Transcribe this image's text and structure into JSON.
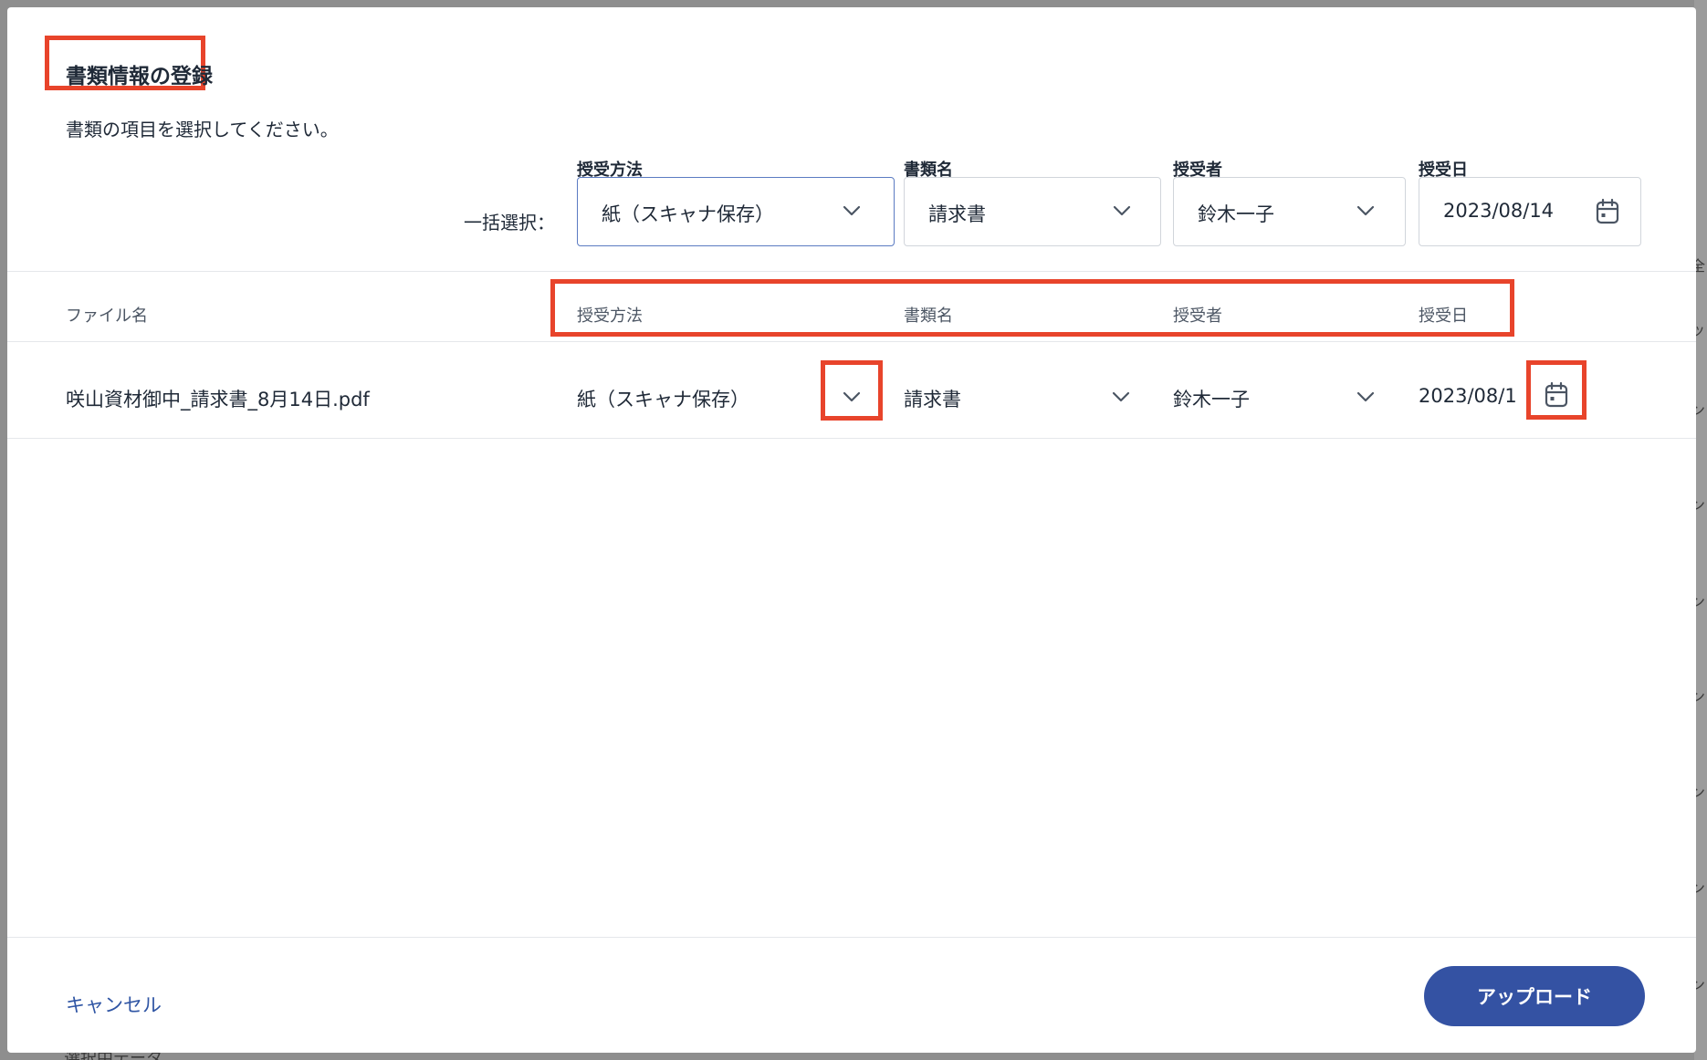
{
  "modal": {
    "title": "書類情報の登録",
    "subtitle": "書類の項目を選択してください。"
  },
  "bulk": {
    "label": "一括選択：",
    "fields": [
      {
        "label": "授受方法",
        "value": "紙（スキャナ保存）",
        "icon": "chevron-down-icon"
      },
      {
        "label": "書類名",
        "value": "請求書",
        "icon": "chevron-down-icon"
      },
      {
        "label": "授受者",
        "value": "鈴木一子",
        "icon": "chevron-down-icon"
      },
      {
        "label": "授受日",
        "value": "2023/08/14",
        "icon": "calendar-icon"
      }
    ]
  },
  "table": {
    "columns": [
      "ファイル名",
      "授受方法",
      "書類名",
      "授受者",
      "授受日"
    ],
    "rows": [
      {
        "filename": "咲山資材御中_請求書_8月14日.pdf",
        "method": "紙（スキャナ保存）",
        "doc_name": "請求書",
        "recipient": "鈴木一子",
        "date": "2023/08/1"
      }
    ]
  },
  "footer": {
    "cancel_label": "キャンセル",
    "upload_label": "アップロード"
  },
  "background": {
    "bottom_text": "選択中データ",
    "edge_glyphs": [
      "(全",
      "ッ",
      "ン",
      "ン",
      "ン",
      "ン",
      "ン",
      "ン",
      "ン",
      "ン",
      "ン"
    ]
  },
  "colors": {
    "highlight": "#e8442b",
    "primary": "#3452a3",
    "link": "#2f55a4",
    "active_border": "#5b7bc2",
    "backdrop": "#8e8e8e"
  }
}
